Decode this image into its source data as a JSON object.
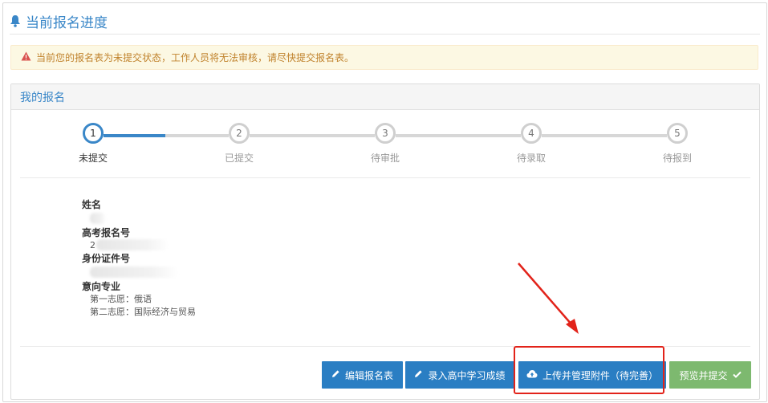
{
  "header": {
    "title": "当前报名进度",
    "icon": "bell-icon"
  },
  "alert": {
    "icon": "warning-icon",
    "text": "当前您的报名表为未提交状态，工作人员将无法审核，请尽快提交报名表。"
  },
  "panel": {
    "title": "我的报名"
  },
  "steps": [
    {
      "num": "1",
      "label": "未提交",
      "active": true
    },
    {
      "num": "2",
      "label": "已提交",
      "active": false
    },
    {
      "num": "3",
      "label": "待审批",
      "active": false
    },
    {
      "num": "4",
      "label": "待录取",
      "active": false
    },
    {
      "num": "5",
      "label": "待报到",
      "active": false
    }
  ],
  "info": {
    "name_label": "姓名",
    "exam_no_label": "高考报名号",
    "exam_no_partial": "2",
    "id_label": "身份证件号",
    "major_label": "意向专业",
    "choice1": "第一志愿：俄语",
    "choice2": "第二志愿：国际经济与贸易"
  },
  "buttons": {
    "edit": "编辑报名表",
    "scores": "录入高中学习成绩",
    "upload": "上传并管理附件（待完善）",
    "submit": "预览并提交"
  },
  "colors": {
    "accent": "#3a87c8",
    "button_primary": "#2a7ec3",
    "button_success": "#7db96f",
    "alert_bg": "#fcf8e3",
    "annotation_red": "#e2231a"
  }
}
